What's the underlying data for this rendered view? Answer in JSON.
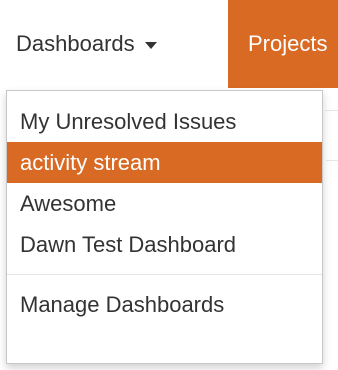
{
  "nav": {
    "dashboards_label": "Dashboards",
    "projects_label": "Projects"
  },
  "dropdown": {
    "items": [
      {
        "label": "My Unresolved Issues",
        "active": false
      },
      {
        "label": "activity stream",
        "active": true
      },
      {
        "label": "Awesome",
        "active": false
      },
      {
        "label": "Dawn Test Dashboard",
        "active": false
      }
    ],
    "manage_label": "Manage Dashboards"
  },
  "colors": {
    "accent": "#d86a24",
    "text": "#333333",
    "active_text": "#ffffff"
  }
}
